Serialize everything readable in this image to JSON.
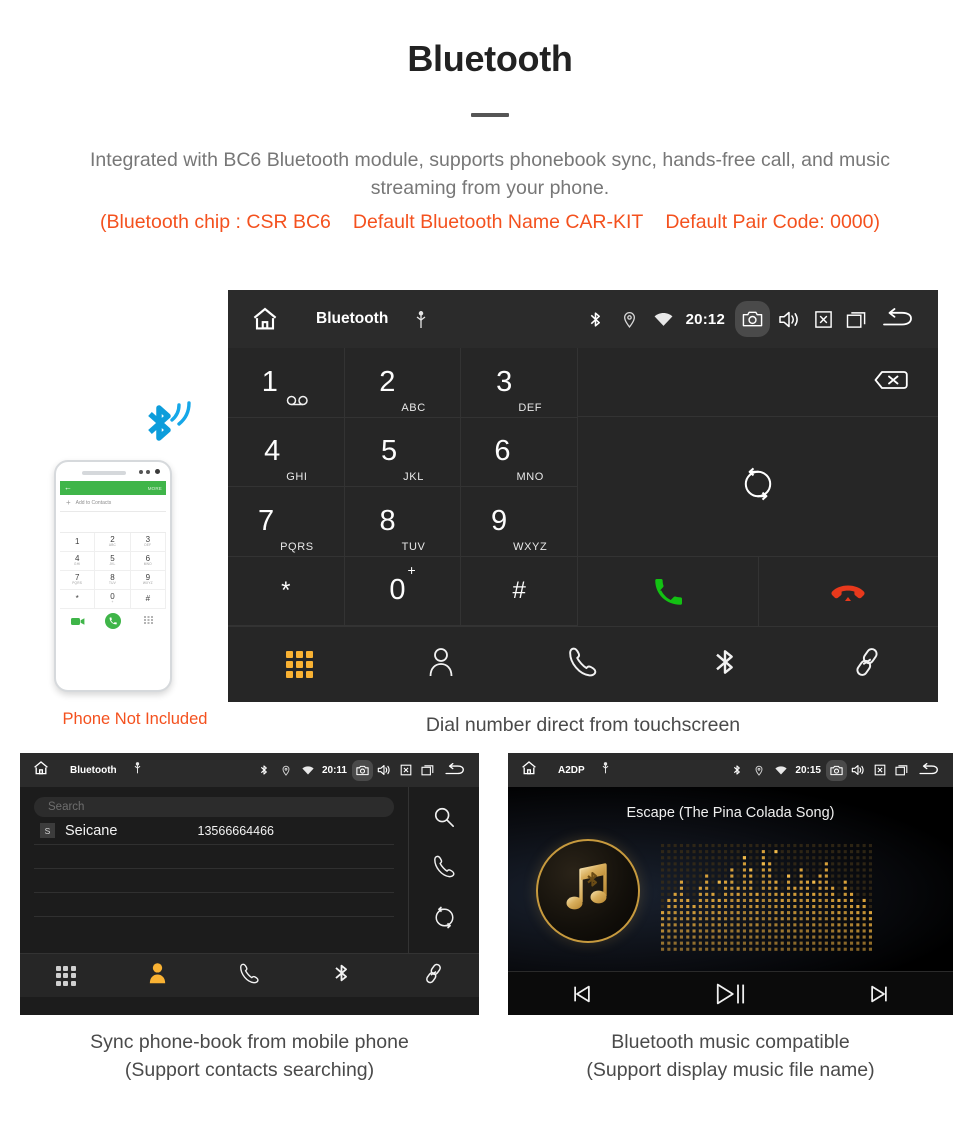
{
  "header": {
    "title": "Bluetooth",
    "subtitle": "Integrated with BC6 Bluetooth module, supports phonebook sync, hands-free call, and music streaming from your phone.",
    "spec_chip": "(Bluetooth chip : CSR BC6",
    "spec_name": "Default Bluetooth Name CAR-KIT",
    "spec_pair": "Default Pair Code: 0000)",
    "accent_color": "#f4511e",
    "title_color": "#222222",
    "subtitle_color": "#777777"
  },
  "dialer": {
    "statusbar": {
      "home_icon": "home-icon",
      "title": "Bluetooth",
      "usb_icon": "usb-icon",
      "bluetooth_icon": "bluetooth-icon",
      "location_icon": "location-pin-icon",
      "wifi_icon": "wifi-icon",
      "time": "20:12",
      "camera_icon": "camera-icon",
      "volume_icon": "speaker-volume-icon",
      "close_icon": "close-box-icon",
      "recents_icon": "recent-apps-icon",
      "back_icon": "back-arrow-icon"
    },
    "keys": [
      {
        "digit": "1",
        "sub": "",
        "icon": "voicemail-icon"
      },
      {
        "digit": "2",
        "sub": "ABC",
        "icon": ""
      },
      {
        "digit": "3",
        "sub": "DEF",
        "icon": ""
      },
      {
        "digit": "4",
        "sub": "GHI",
        "icon": ""
      },
      {
        "digit": "5",
        "sub": "JKL",
        "icon": ""
      },
      {
        "digit": "6",
        "sub": "MNO",
        "icon": ""
      },
      {
        "digit": "7",
        "sub": "PQRS",
        "icon": ""
      },
      {
        "digit": "8",
        "sub": "TUV",
        "icon": ""
      },
      {
        "digit": "9",
        "sub": "WXYZ",
        "icon": ""
      },
      {
        "digit": "*",
        "sub": "",
        "icon": ""
      },
      {
        "digit": "0",
        "sub": "+",
        "icon": ""
      },
      {
        "digit": "#",
        "sub": "",
        "icon": ""
      }
    ],
    "display_value": "",
    "backspace_icon": "backspace-icon",
    "sync_icon": "sync-refresh-icon",
    "call_icon": "call-answer-icon",
    "call_color": "#13c113",
    "end_icon": "call-end-icon",
    "end_color": "#e8391c",
    "nav": [
      {
        "name": "dialpad",
        "icon": "dialpad-icon",
        "active": true
      },
      {
        "name": "contacts",
        "icon": "contact-person-icon",
        "active": false
      },
      {
        "name": "call-log",
        "icon": "phone-handset-icon",
        "active": false
      },
      {
        "name": "bluetooth",
        "icon": "bluetooth-icon",
        "active": false
      },
      {
        "name": "link",
        "icon": "link-chain-icon",
        "active": false
      }
    ],
    "active_color": "#f9b233",
    "caption": "Dial number direct from touchscreen"
  },
  "phone_illustration": {
    "bluetooth_icon": "bluetooth-wireless-icon",
    "bluetooth_color": "#0d9ddb",
    "screen": {
      "more_label": "MORE",
      "add_contacts_label": "Add to Contacts",
      "keys": [
        {
          "d": "1",
          "s": ""
        },
        {
          "d": "2",
          "s": "ABC"
        },
        {
          "d": "3",
          "s": "DEF"
        },
        {
          "d": "4",
          "s": "GHI"
        },
        {
          "d": "5",
          "s": "JKL"
        },
        {
          "d": "6",
          "s": "MNO"
        },
        {
          "d": "7",
          "s": "PQRS"
        },
        {
          "d": "8",
          "s": "TUV"
        },
        {
          "d": "9",
          "s": "WXYZ"
        },
        {
          "d": "*",
          "s": ""
        },
        {
          "d": "0",
          "s": "+"
        },
        {
          "d": "#",
          "s": ""
        }
      ]
    },
    "note": "Phone Not Included",
    "note_color": "#f4511e"
  },
  "phonebook": {
    "statusbar": {
      "title": "Bluetooth",
      "time": "20:11"
    },
    "search_placeholder": "Search",
    "contacts": [
      {
        "initial": "S",
        "name": "Seicane",
        "number": "13566664466"
      }
    ],
    "side_icons": [
      {
        "name": "search-icon"
      },
      {
        "name": "phone-handset-icon"
      },
      {
        "name": "sync-refresh-icon"
      }
    ],
    "nav": [
      {
        "name": "dialpad",
        "active": false
      },
      {
        "name": "contacts",
        "active": true
      },
      {
        "name": "call-log",
        "active": false
      },
      {
        "name": "bluetooth",
        "active": false
      },
      {
        "name": "link",
        "active": false
      }
    ],
    "caption_line1": "Sync phone-book from mobile phone",
    "caption_line2": "(Support contacts searching)"
  },
  "music": {
    "statusbar": {
      "title": "A2DP",
      "time": "20:15"
    },
    "track_title": "Escape (The Pina Colada Song)",
    "album_icon": "music-note-bluetooth-icon",
    "accent_color": "#c79a3e",
    "controls": [
      {
        "name": "previous-track-button",
        "icon": "skip-previous-icon"
      },
      {
        "name": "play-pause-button",
        "icon": "play-pause-icon"
      },
      {
        "name": "next-track-button",
        "icon": "skip-next-icon"
      }
    ],
    "caption_line1": "Bluetooth music compatible",
    "caption_line2": "(Support display music file name)"
  }
}
